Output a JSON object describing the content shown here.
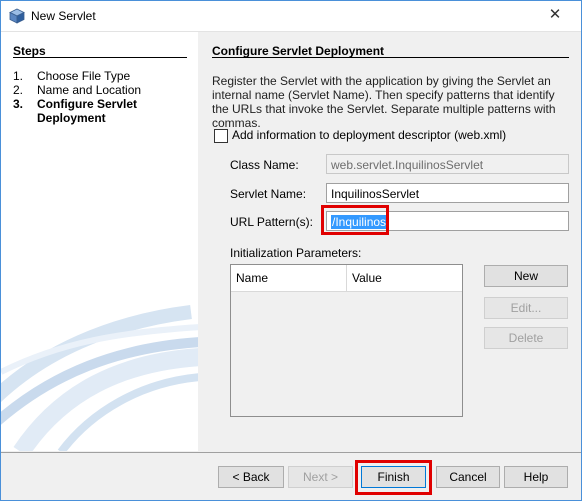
{
  "window": {
    "title": "New Servlet",
    "close_glyph": "✕"
  },
  "steps": {
    "title": "Steps",
    "items": [
      {
        "num": "1.",
        "label": "Choose File Type"
      },
      {
        "num": "2.",
        "label": "Name and Location"
      },
      {
        "num": "3.",
        "label": "Configure Servlet Deployment"
      }
    ],
    "current_index": 2
  },
  "main": {
    "title": "Configure Servlet Deployment",
    "description": "Register the Servlet with the application by giving the Servlet an internal name (Servlet Name). Then specify patterns that identify the URLs that invoke the Servlet. Separate multiple patterns with commas.",
    "deployment_descriptor": {
      "label": "Add information to deployment descriptor (web.xml)",
      "checked": false
    },
    "class_name": {
      "label": "Class Name:",
      "value": "web.servlet.InquilinosServlet",
      "enabled": false
    },
    "servlet_name": {
      "label": "Servlet Name:",
      "value": "InquilinosServlet"
    },
    "url_pattern": {
      "label": "URL Pattern(s):",
      "value": "/Inquilinos",
      "selected": true
    },
    "init_params": {
      "label": "Initialization Parameters:",
      "columns": [
        "Name",
        "Value"
      ],
      "rows": []
    },
    "buttons": {
      "new": "New",
      "edit": "Edit...",
      "delete": "Delete"
    }
  },
  "footer": {
    "back": "< Back",
    "next": "Next >",
    "finish": "Finish",
    "cancel": "Cancel",
    "help": "Help"
  },
  "colors": {
    "highlight": "#e00000",
    "selection": "#3399ff",
    "panel": "#f0f0f0"
  }
}
